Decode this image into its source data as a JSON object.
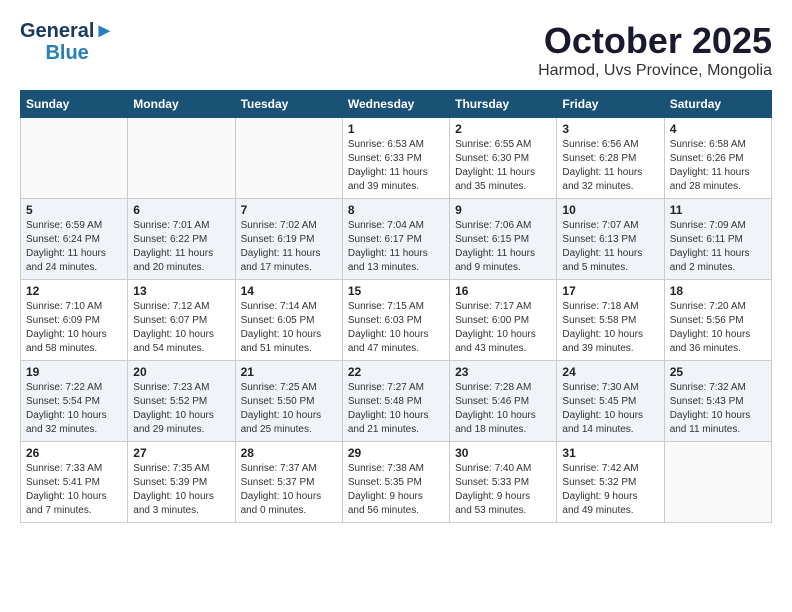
{
  "header": {
    "logo_line1": "General",
    "logo_line2": "Blue",
    "month": "October 2025",
    "location": "Harmod, Uvs Province, Mongolia"
  },
  "weekdays": [
    "Sunday",
    "Monday",
    "Tuesday",
    "Wednesday",
    "Thursday",
    "Friday",
    "Saturday"
  ],
  "weeks": [
    [
      {
        "day": "",
        "info": ""
      },
      {
        "day": "",
        "info": ""
      },
      {
        "day": "",
        "info": ""
      },
      {
        "day": "1",
        "info": "Sunrise: 6:53 AM\nSunset: 6:33 PM\nDaylight: 11 hours\nand 39 minutes."
      },
      {
        "day": "2",
        "info": "Sunrise: 6:55 AM\nSunset: 6:30 PM\nDaylight: 11 hours\nand 35 minutes."
      },
      {
        "day": "3",
        "info": "Sunrise: 6:56 AM\nSunset: 6:28 PM\nDaylight: 11 hours\nand 32 minutes."
      },
      {
        "day": "4",
        "info": "Sunrise: 6:58 AM\nSunset: 6:26 PM\nDaylight: 11 hours\nand 28 minutes."
      }
    ],
    [
      {
        "day": "5",
        "info": "Sunrise: 6:59 AM\nSunset: 6:24 PM\nDaylight: 11 hours\nand 24 minutes."
      },
      {
        "day": "6",
        "info": "Sunrise: 7:01 AM\nSunset: 6:22 PM\nDaylight: 11 hours\nand 20 minutes."
      },
      {
        "day": "7",
        "info": "Sunrise: 7:02 AM\nSunset: 6:19 PM\nDaylight: 11 hours\nand 17 minutes."
      },
      {
        "day": "8",
        "info": "Sunrise: 7:04 AM\nSunset: 6:17 PM\nDaylight: 11 hours\nand 13 minutes."
      },
      {
        "day": "9",
        "info": "Sunrise: 7:06 AM\nSunset: 6:15 PM\nDaylight: 11 hours\nand 9 minutes."
      },
      {
        "day": "10",
        "info": "Sunrise: 7:07 AM\nSunset: 6:13 PM\nDaylight: 11 hours\nand 5 minutes."
      },
      {
        "day": "11",
        "info": "Sunrise: 7:09 AM\nSunset: 6:11 PM\nDaylight: 11 hours\nand 2 minutes."
      }
    ],
    [
      {
        "day": "12",
        "info": "Sunrise: 7:10 AM\nSunset: 6:09 PM\nDaylight: 10 hours\nand 58 minutes."
      },
      {
        "day": "13",
        "info": "Sunrise: 7:12 AM\nSunset: 6:07 PM\nDaylight: 10 hours\nand 54 minutes."
      },
      {
        "day": "14",
        "info": "Sunrise: 7:14 AM\nSunset: 6:05 PM\nDaylight: 10 hours\nand 51 minutes."
      },
      {
        "day": "15",
        "info": "Sunrise: 7:15 AM\nSunset: 6:03 PM\nDaylight: 10 hours\nand 47 minutes."
      },
      {
        "day": "16",
        "info": "Sunrise: 7:17 AM\nSunset: 6:00 PM\nDaylight: 10 hours\nand 43 minutes."
      },
      {
        "day": "17",
        "info": "Sunrise: 7:18 AM\nSunset: 5:58 PM\nDaylight: 10 hours\nand 39 minutes."
      },
      {
        "day": "18",
        "info": "Sunrise: 7:20 AM\nSunset: 5:56 PM\nDaylight: 10 hours\nand 36 minutes."
      }
    ],
    [
      {
        "day": "19",
        "info": "Sunrise: 7:22 AM\nSunset: 5:54 PM\nDaylight: 10 hours\nand 32 minutes."
      },
      {
        "day": "20",
        "info": "Sunrise: 7:23 AM\nSunset: 5:52 PM\nDaylight: 10 hours\nand 29 minutes."
      },
      {
        "day": "21",
        "info": "Sunrise: 7:25 AM\nSunset: 5:50 PM\nDaylight: 10 hours\nand 25 minutes."
      },
      {
        "day": "22",
        "info": "Sunrise: 7:27 AM\nSunset: 5:48 PM\nDaylight: 10 hours\nand 21 minutes."
      },
      {
        "day": "23",
        "info": "Sunrise: 7:28 AM\nSunset: 5:46 PM\nDaylight: 10 hours\nand 18 minutes."
      },
      {
        "day": "24",
        "info": "Sunrise: 7:30 AM\nSunset: 5:45 PM\nDaylight: 10 hours\nand 14 minutes."
      },
      {
        "day": "25",
        "info": "Sunrise: 7:32 AM\nSunset: 5:43 PM\nDaylight: 10 hours\nand 11 minutes."
      }
    ],
    [
      {
        "day": "26",
        "info": "Sunrise: 7:33 AM\nSunset: 5:41 PM\nDaylight: 10 hours\nand 7 minutes."
      },
      {
        "day": "27",
        "info": "Sunrise: 7:35 AM\nSunset: 5:39 PM\nDaylight: 10 hours\nand 3 minutes."
      },
      {
        "day": "28",
        "info": "Sunrise: 7:37 AM\nSunset: 5:37 PM\nDaylight: 10 hours\nand 0 minutes."
      },
      {
        "day": "29",
        "info": "Sunrise: 7:38 AM\nSunset: 5:35 PM\nDaylight: 9 hours\nand 56 minutes."
      },
      {
        "day": "30",
        "info": "Sunrise: 7:40 AM\nSunset: 5:33 PM\nDaylight: 9 hours\nand 53 minutes."
      },
      {
        "day": "31",
        "info": "Sunrise: 7:42 AM\nSunset: 5:32 PM\nDaylight: 9 hours\nand 49 minutes."
      },
      {
        "day": "",
        "info": ""
      }
    ]
  ]
}
